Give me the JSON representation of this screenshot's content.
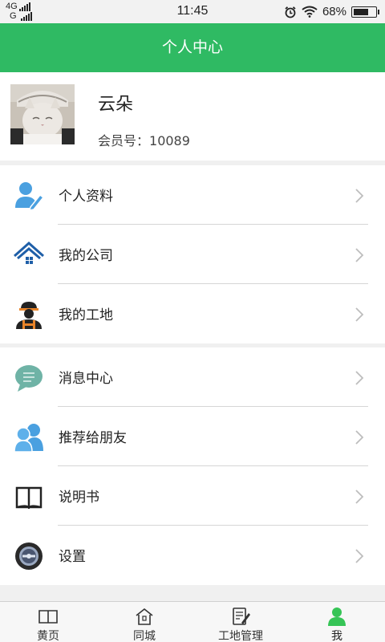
{
  "status_bar": {
    "network_top": "4G",
    "network_bottom": "G",
    "time": "11:45",
    "battery": "68%",
    "battery_level": 0.68
  },
  "header": {
    "title": "个人中心"
  },
  "profile": {
    "name": "云朵",
    "member_label": "会员号：",
    "member_id": "10089"
  },
  "menu_groups": [
    [
      {
        "label": "个人资料",
        "icon": "user-edit-icon"
      },
      {
        "label": "我的公司",
        "icon": "company-house-icon"
      },
      {
        "label": "我的工地",
        "icon": "construction-worker-icon"
      }
    ],
    [
      {
        "label": "消息中心",
        "icon": "message-bubble-icon"
      },
      {
        "label": "推荐给朋友",
        "icon": "friends-icon"
      },
      {
        "label": "说明书",
        "icon": "manual-book-icon"
      },
      {
        "label": "设置",
        "icon": "settings-dial-icon"
      }
    ]
  ],
  "tabs": [
    {
      "label": "黄页",
      "icon": "book-icon"
    },
    {
      "label": "同城",
      "icon": "home-icon"
    },
    {
      "label": "工地管理",
      "icon": "notepad-icon"
    },
    {
      "label": "我",
      "icon": "person-icon",
      "active": true
    }
  ],
  "colors": {
    "brand_green": "#2fba63",
    "icon_blue": "#4aa0e0",
    "active_tab_green": "#36c456"
  }
}
